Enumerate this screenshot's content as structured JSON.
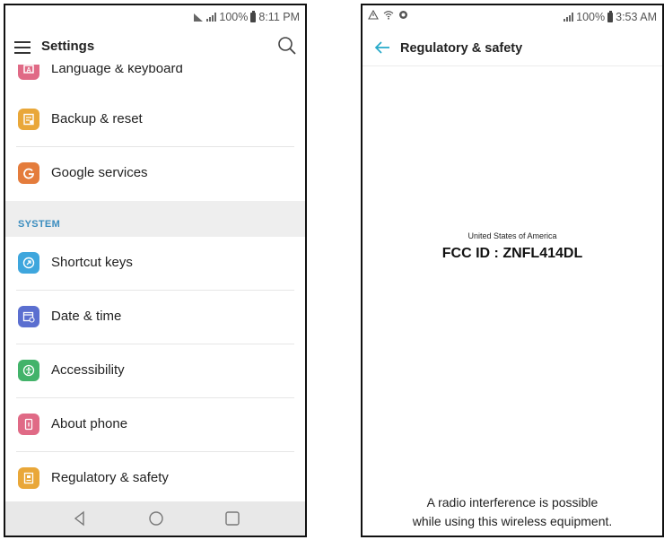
{
  "left_phone": {
    "status": {
      "battery": "100%",
      "time": "8:11 PM"
    },
    "header": {
      "title": "Settings"
    },
    "items_top": [
      {
        "label": "Language & keyboard",
        "icon": "keyboard-icon",
        "color": "#e06a86"
      },
      {
        "label": "Backup & reset",
        "icon": "backup-icon",
        "color": "#e9a739"
      },
      {
        "label": "Google services",
        "icon": "google-icon",
        "color": "#e47c3c"
      }
    ],
    "section_label": "SYSTEM",
    "items_system": [
      {
        "label": "Shortcut keys",
        "icon": "shortcut-icon",
        "color": "#3ea6dd"
      },
      {
        "label": "Date & time",
        "icon": "calendar-clock-icon",
        "color": "#5b6fd0"
      },
      {
        "label": "Accessibility",
        "icon": "accessibility-icon",
        "color": "#43b36a"
      },
      {
        "label": "About phone",
        "icon": "phone-info-icon",
        "color": "#e06a86"
      },
      {
        "label": "Regulatory & safety",
        "icon": "regulatory-icon",
        "color": "#e9a739"
      }
    ]
  },
  "right_phone": {
    "status": {
      "battery": "100%",
      "time": "3:53 AM"
    },
    "header": {
      "title": "Regulatory & safety"
    },
    "accent": "#26a9c9",
    "country": "United States of America",
    "fcc_id": "FCC ID : ZNFL414DL",
    "notice_line1": "A radio interference is possible",
    "notice_line2": "while using this wireless equipment."
  }
}
